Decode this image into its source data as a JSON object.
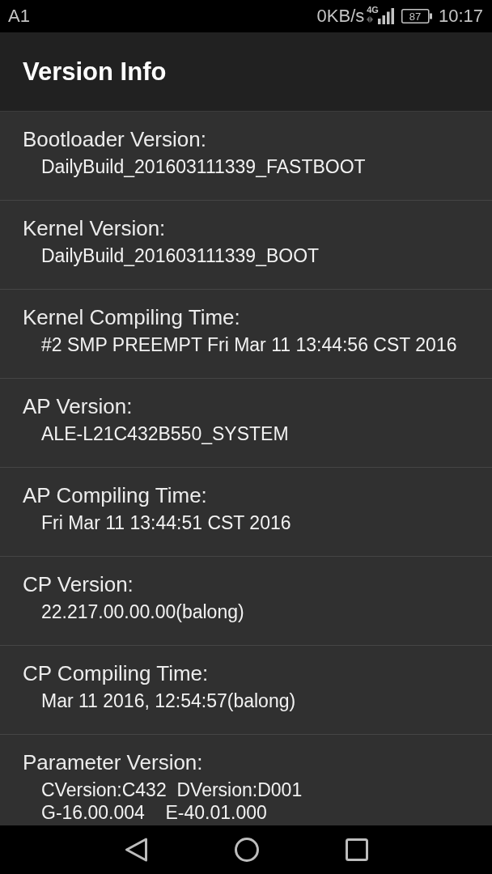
{
  "status_bar": {
    "carrier": "A1",
    "speed": "0KB/s",
    "network": "4G",
    "battery": "87",
    "time": "10:17"
  },
  "app_bar": {
    "title": "Version Info"
  },
  "items": [
    {
      "label": "Bootloader Version:",
      "values": [
        "DailyBuild_201603111339_FASTBOOT"
      ]
    },
    {
      "label": "Kernel Version:",
      "values": [
        "DailyBuild_201603111339_BOOT"
      ]
    },
    {
      "label": "Kernel Compiling Time:",
      "values": [
        "#2 SMP PREEMPT Fri Mar 11 13:44:56 CST 2016"
      ]
    },
    {
      "label": "AP Version:",
      "values": [
        "ALE-L21C432B550_SYSTEM"
      ]
    },
    {
      "label": "AP Compiling Time:",
      "values": [
        "Fri Mar 11 13:44:51 CST 2016"
      ]
    },
    {
      "label": "CP Version:",
      "values": [
        "22.217.00.00.00(balong)"
      ]
    },
    {
      "label": "CP Compiling Time:",
      "values": [
        "Mar 11 2016, 12:54:57(balong)"
      ]
    },
    {
      "label": "Parameter Version:",
      "values": [
        "CVersion:C432  DVersion:D001",
        "G-16.00.004    E-40.01.000"
      ]
    }
  ]
}
